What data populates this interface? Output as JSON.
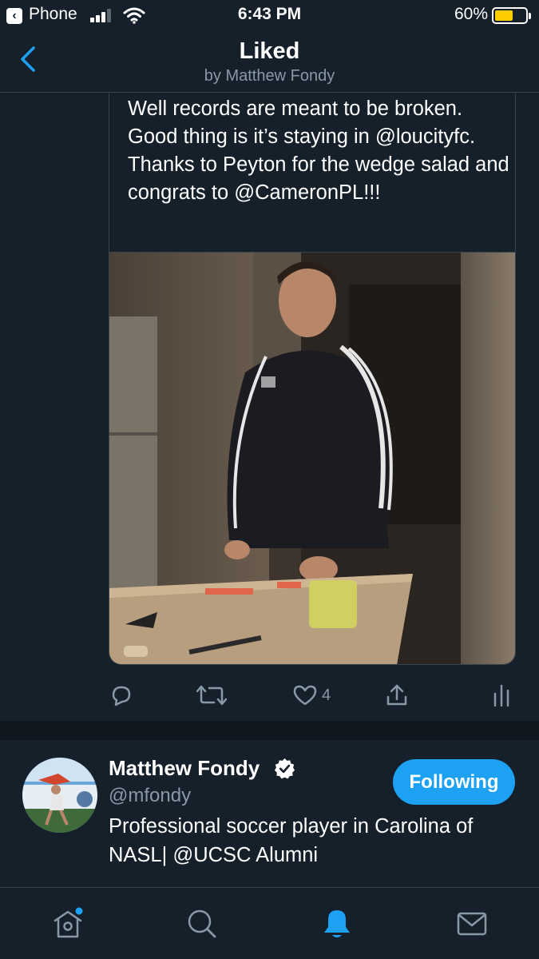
{
  "status_bar": {
    "carrier": "Phone",
    "time": "6:43 PM",
    "battery_percent": "60%",
    "battery_level": 0.6,
    "battery_color": "#ffcc00"
  },
  "header": {
    "title": "Liked",
    "subtitle": "by Matthew Fondy"
  },
  "tweet": {
    "text": "Well records are meant to be broken. Good thing is it’s staying in @loucityfc. Thanks to Peyton for the wedge salad and congrats to @CameronPL!!!",
    "media": "video",
    "like_count": "4",
    "actions": [
      "reply-icon",
      "retweet-icon",
      "like-icon",
      "share-icon",
      "analytics-icon"
    ]
  },
  "profile": {
    "name": "Matthew Fondy",
    "handle": "@mfondy",
    "verified": true,
    "bio": "Professional soccer player in Carolina of NASL| @UCSC Alumni",
    "follow_button_label": "Following"
  },
  "tab_bar": {
    "items": [
      "home-icon",
      "search-icon",
      "notifications-icon",
      "messages-icon"
    ],
    "active": "notifications-icon",
    "home_has_badge": true
  },
  "colors": {
    "background": "#15202b",
    "accent": "#1da1f2",
    "secondary_text": "#8899a6",
    "border": "#38444d"
  }
}
